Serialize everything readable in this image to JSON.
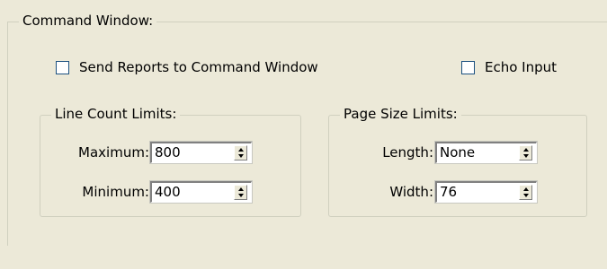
{
  "command_window": {
    "title": "Command Window:",
    "send_reports": {
      "label": "Send Reports to Command Window",
      "checked": false
    },
    "echo_input": {
      "label": "Echo Input",
      "checked": false
    }
  },
  "line_count": {
    "title": "Line Count Limits:",
    "maximum": {
      "label": "Maximum:",
      "value": "800"
    },
    "minimum": {
      "label": "Minimum:",
      "value": "400"
    }
  },
  "page_size": {
    "title": "Page Size Limits:",
    "length": {
      "label": "Length:",
      "value": "None"
    },
    "width": {
      "label": "Width:",
      "value": "76"
    }
  }
}
